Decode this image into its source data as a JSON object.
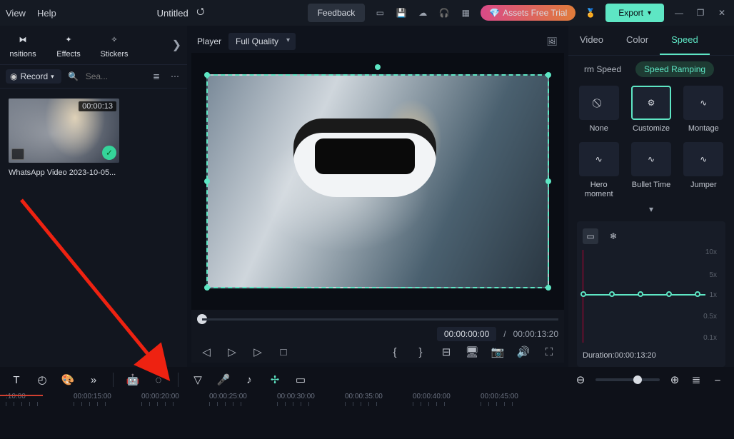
{
  "menu": {
    "view": "View",
    "help": "Help"
  },
  "title": "Untitled",
  "topbar": {
    "feedback": "Feedback",
    "assets": "Assets Free Trial",
    "export": "Export"
  },
  "leftTabs": [
    "nsitions",
    "Effects",
    "Stickers"
  ],
  "record": "Record",
  "search_ph": "Sea...",
  "clip": {
    "duration": "00:00:13",
    "name": "WhatsApp Video 2023-10-05..."
  },
  "player": {
    "label": "Player",
    "quality": "Full Quality",
    "current": "00:00:00:00",
    "total": "00:00:13:20"
  },
  "rtabs": {
    "video": "Video",
    "color": "Color",
    "speed": "Speed"
  },
  "subtabs": {
    "uniform": "rm Speed",
    "ramp": "Speed Ramping"
  },
  "presets": [
    "None",
    "Customize",
    "Montage",
    "Hero moment",
    "Bullet Time",
    "Jumper"
  ],
  "graph": {
    "ylabels": [
      "10x",
      "5x",
      "1x",
      "0.5x",
      "0.1x"
    ],
    "duration_label": "Duration:",
    "duration": "00:00:13:20"
  },
  "ruler": [
    ":10:00",
    "00:00:15:00",
    "00:00:20:00",
    "00:00:25:00",
    "00:00:30:00",
    "00:00:35:00",
    "00:00:40:00",
    "00:00:45:00"
  ]
}
